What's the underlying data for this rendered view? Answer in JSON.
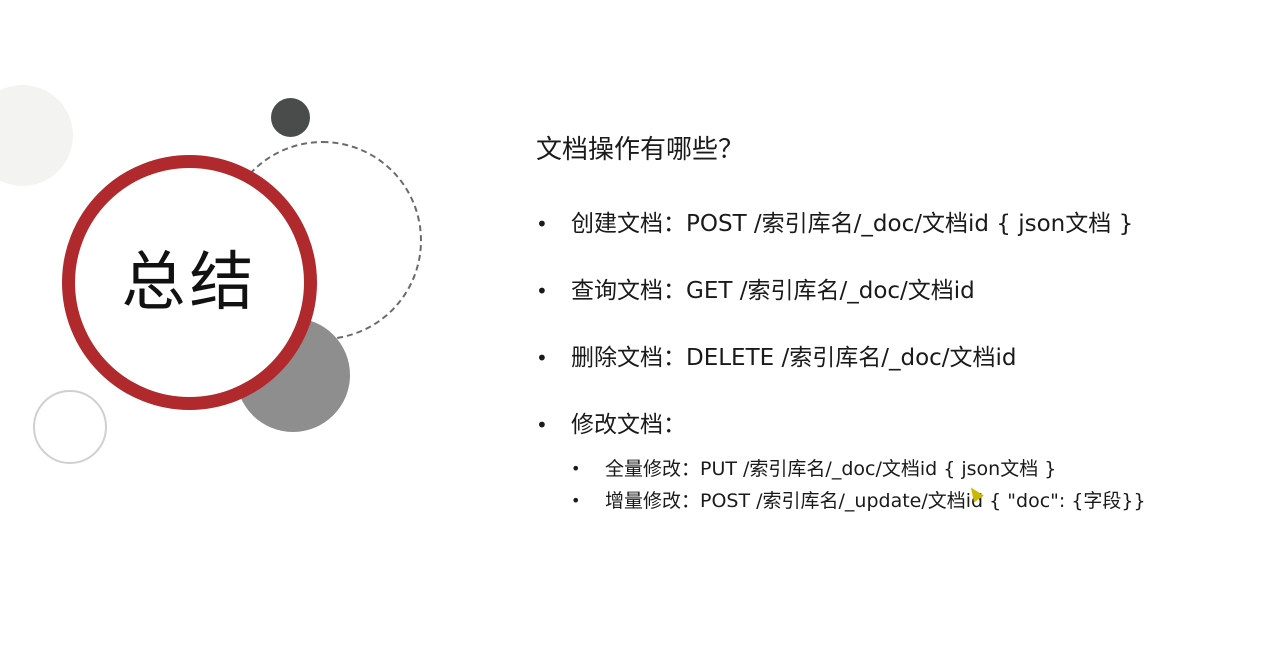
{
  "slide": {
    "title": "总结",
    "question": "文档操作有哪些？",
    "items": [
      {
        "label": "创建文档：POST /索引库名/_doc/文档id  { json文档 }"
      },
      {
        "label": "查询文档：GET /索引库名/_doc/文档id"
      },
      {
        "label": "删除文档：DELETE /索引库名/_doc/文档id"
      },
      {
        "label": "修改文档："
      }
    ],
    "sub_items": [
      {
        "label": "全量修改：PUT /索引库名/_doc/文档id { json文档 }"
      },
      {
        "label": "增量修改：POST /索引库名/_update/文档id { \"doc\": {字段}}"
      }
    ]
  },
  "colors": {
    "ring": "#b0292d",
    "dark_dot": "#4a4b4b",
    "grey_disc": "#8e8e8e",
    "background": "#ffffff"
  },
  "icons": {
    "cursor": "mouse-pointer-icon"
  }
}
